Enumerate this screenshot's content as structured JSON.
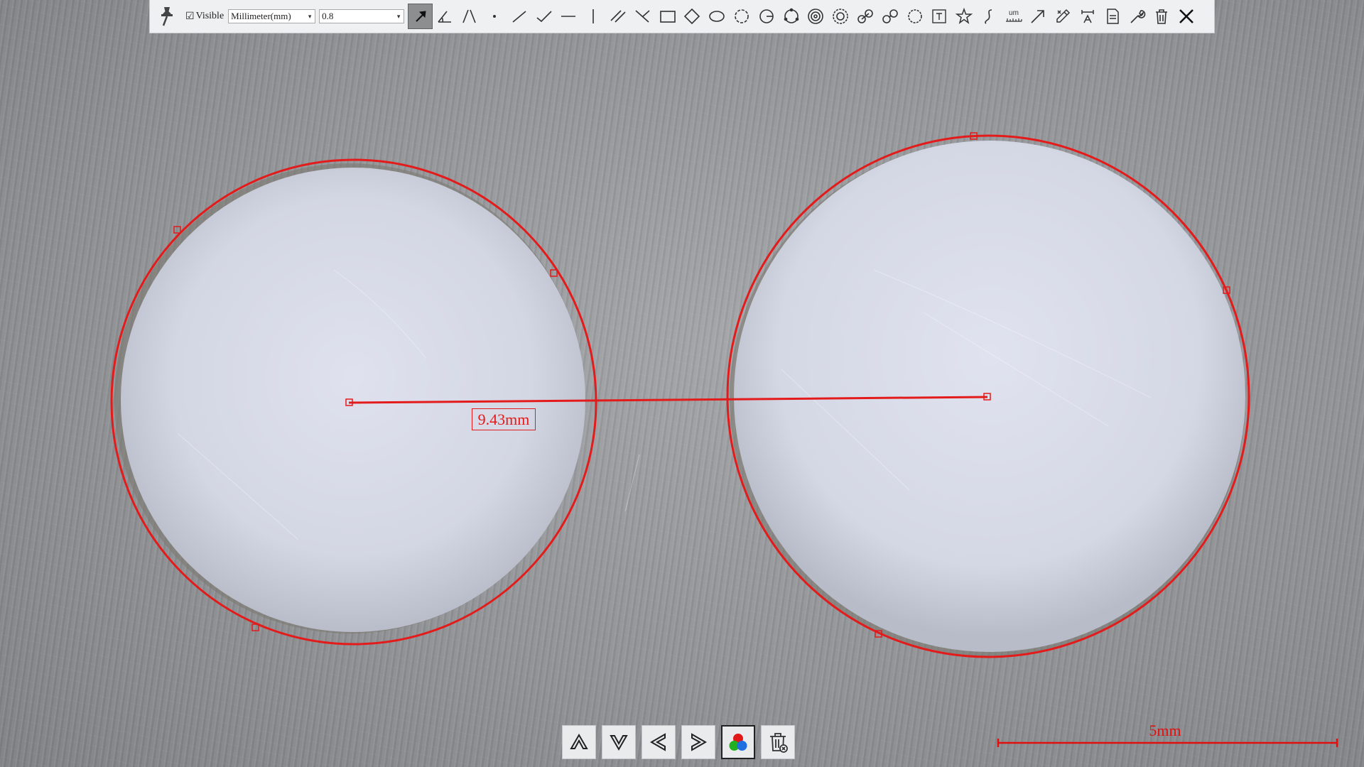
{
  "toolbar": {
    "visible_label": "Visible",
    "visible_checked": true,
    "unit_select": "Millimeter(mm)",
    "line_width_select": "0.8",
    "tools": [
      {
        "name": "select-arrow-icon",
        "active": true
      },
      {
        "name": "angle-icon"
      },
      {
        "name": "two-lines-angle-icon"
      },
      {
        "name": "point-icon"
      },
      {
        "name": "line-icon"
      },
      {
        "name": "polyline-icon"
      },
      {
        "name": "horizontal-line-icon"
      },
      {
        "name": "vertical-line-icon"
      },
      {
        "name": "parallel-lines-icon"
      },
      {
        "name": "perpendicular-lines-icon"
      },
      {
        "name": "rectangle-icon"
      },
      {
        "name": "diamond-icon"
      },
      {
        "name": "ellipse-icon"
      },
      {
        "name": "circle-points-icon"
      },
      {
        "name": "circle-radius-icon"
      },
      {
        "name": "circle-three-point-icon"
      },
      {
        "name": "concentric-circles-icon"
      },
      {
        "name": "double-circle-icon"
      },
      {
        "name": "circle-distance-icon"
      },
      {
        "name": "circle-link-icon"
      },
      {
        "name": "arc-icon"
      },
      {
        "name": "text-icon"
      },
      {
        "name": "star-icon"
      },
      {
        "name": "curve-icon"
      },
      {
        "name": "ruler-um-icon"
      },
      {
        "name": "arrow-icon"
      },
      {
        "name": "eraser-pen-icon"
      },
      {
        "name": "calibration-icon"
      },
      {
        "name": "export-icon"
      },
      {
        "name": "wrench-icon"
      },
      {
        "name": "trash-icon"
      },
      {
        "name": "close-icon"
      }
    ],
    "unit_label": "um"
  },
  "measurement": {
    "distance_label": "9.43mm"
  },
  "scale_bar": {
    "label": "5mm"
  },
  "bottom_nav": [
    {
      "name": "move-up-button",
      "icon": "chevron-up-icon"
    },
    {
      "name": "move-down-button",
      "icon": "chevron-down-icon"
    },
    {
      "name": "move-left-button",
      "icon": "chevron-left-icon"
    },
    {
      "name": "move-right-button",
      "icon": "chevron-right-icon"
    },
    {
      "name": "color-button",
      "icon": "rgb-circles-icon",
      "selected": true
    },
    {
      "name": "clear-all-button",
      "icon": "trash-clear-icon"
    }
  ],
  "colors": {
    "measure_red": "#e31b1b",
    "toolbar_bg": "#eef0f1",
    "dish_fill": "#d6d9e6"
  }
}
